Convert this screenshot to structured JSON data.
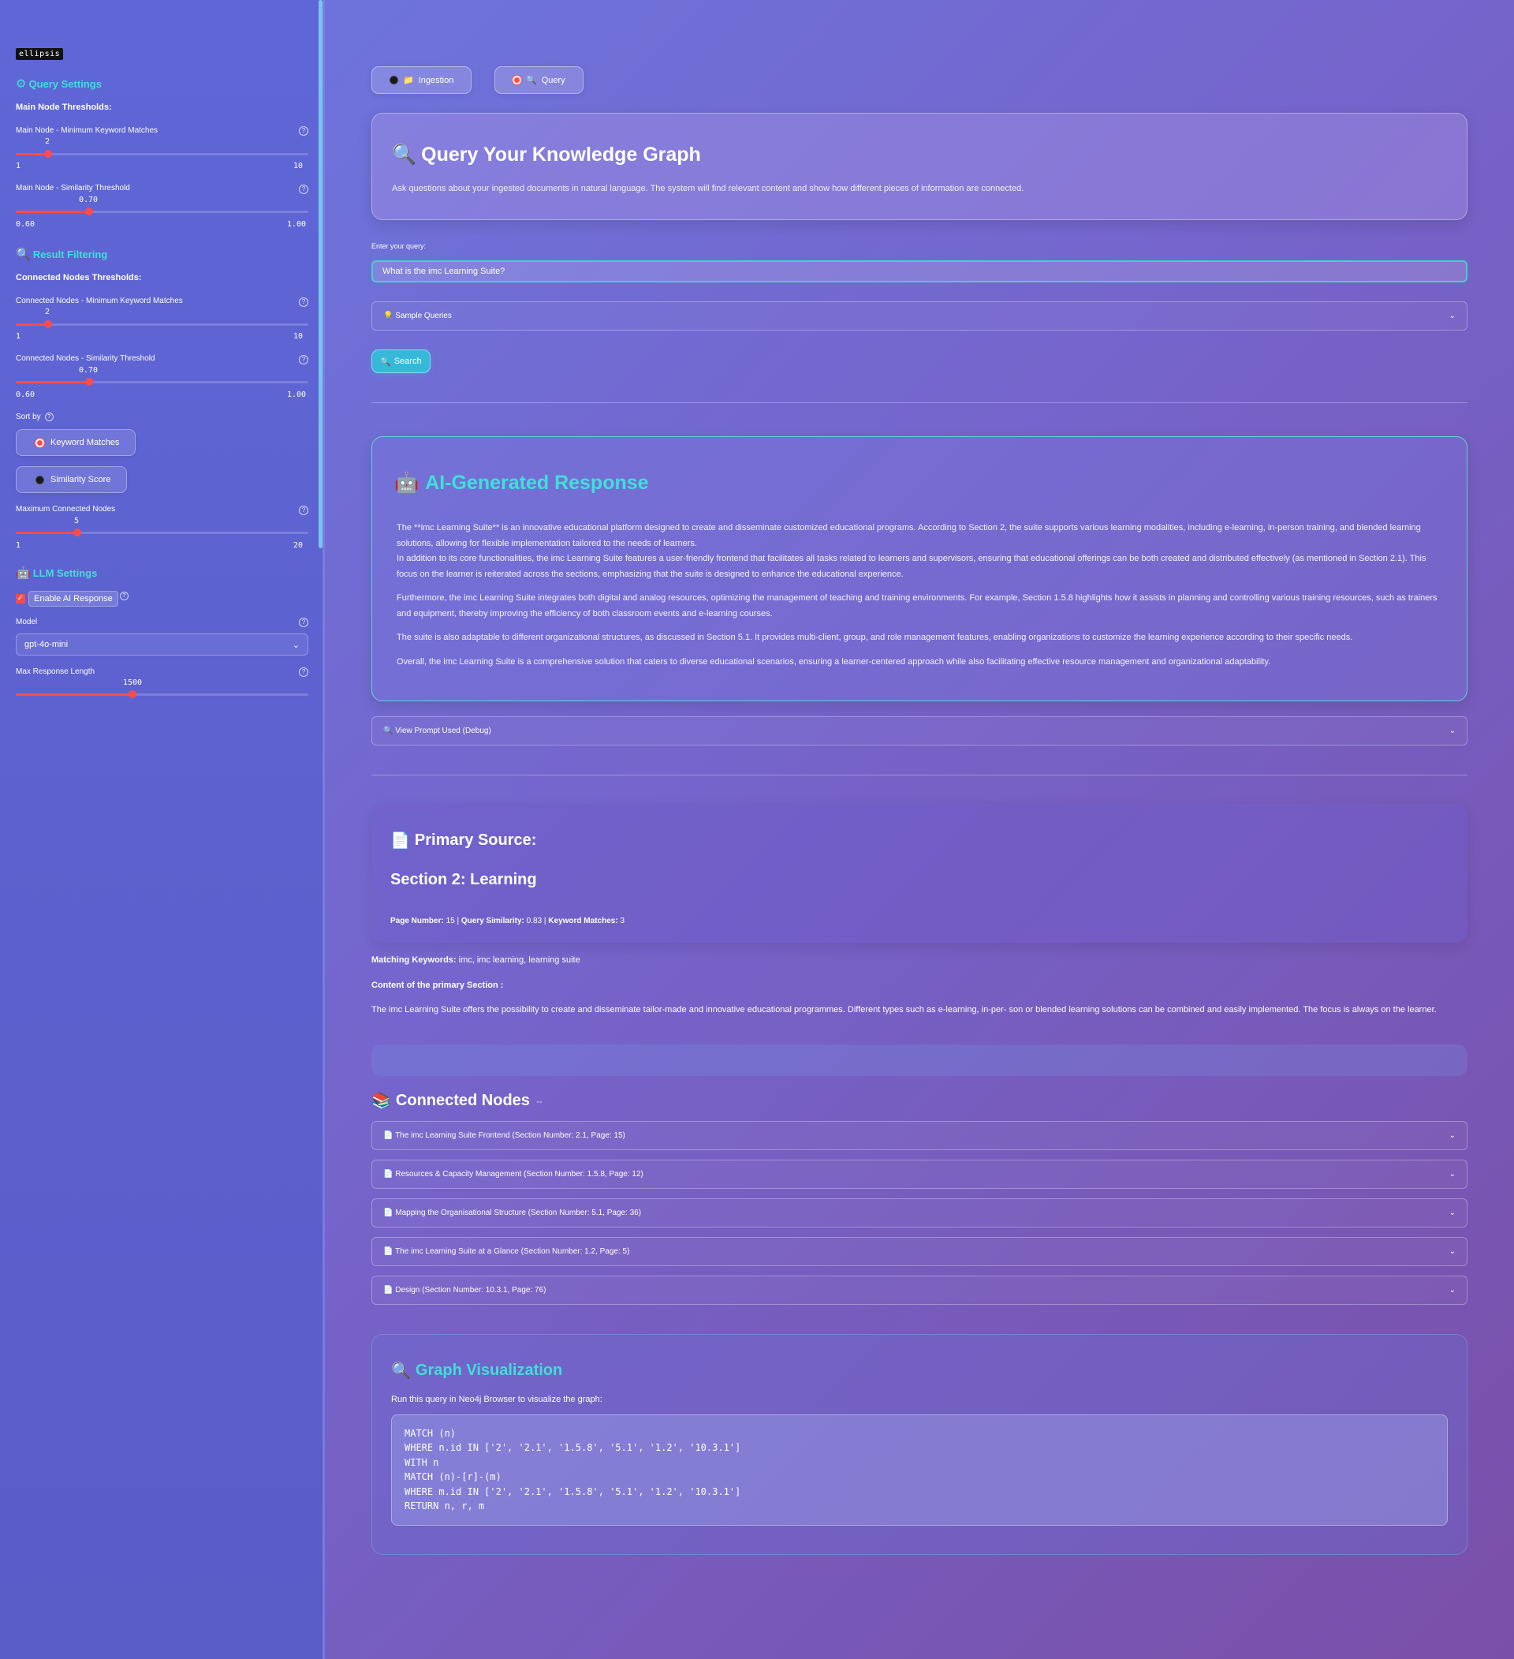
{
  "sidebar": {
    "brand": "ellipsis",
    "query_settings": {
      "title": "Query Settings",
      "main_thresholds_label": "Main Node Thresholds:",
      "min_keyword": {
        "label": "Main Node - Minimum Keyword Matches",
        "value": "2",
        "min": "1",
        "max": "10",
        "fraction": 0.111
      },
      "similarity": {
        "label": "Main Node - Similarity Threshold",
        "value": "0.70",
        "min": "0.60",
        "max": "1.00",
        "fraction": 0.25
      }
    },
    "result_filtering": {
      "title": "Result Filtering",
      "connected_thresholds_label": "Connected Nodes Thresholds:",
      "min_keyword": {
        "label": "Connected Nodes - Minimum Keyword Matches",
        "value": "2",
        "min": "1",
        "max": "10",
        "fraction": 0.111
      },
      "similarity": {
        "label": "Connected Nodes - Similarity Threshold",
        "value": "0.70",
        "min": "0.60",
        "max": "1.00",
        "fraction": 0.25
      },
      "sort_by_label": "Sort by",
      "sort_options": [
        {
          "label": "Keyword Matches",
          "selected": true
        },
        {
          "label": "Similarity Score",
          "selected": false
        }
      ],
      "max_connected": {
        "label": "Maximum Connected Nodes",
        "value": "5",
        "min": "1",
        "max": "20",
        "fraction": 0.21
      }
    },
    "llm_settings": {
      "title": "LLM Settings",
      "enable_ai_label": "Enable AI Response",
      "enable_ai_checked": true,
      "model_label": "Model",
      "model_value": "gpt-4o-mini",
      "max_length": {
        "label": "Max Response Length",
        "value": "1500",
        "fraction": 0.4
      }
    }
  },
  "tabs": [
    {
      "label": "Ingestion",
      "icon": "folder-icon",
      "selected": false
    },
    {
      "label": "Query",
      "icon": "magnifier-icon",
      "selected": true
    }
  ],
  "hero": {
    "title": "Query Your Knowledge Graph",
    "description": "Ask questions about your ingested documents in natural language. The system will find relevant content and show how different pieces of information are connected."
  },
  "query": {
    "label": "Enter your query:",
    "value": "What is the imc Learning Suite?",
    "sample_queries_label": "Sample Queries",
    "search_label": "Search"
  },
  "ai_response": {
    "title": "AI-Generated Response",
    "paragraphs": [
      "The **imc Learning Suite** is an innovative educational platform designed to create and disseminate customized educational programs. According to Section 2, the suite supports various learning modalities, including e-learning, in-person training, and blended learning solutions, allowing for flexible implementation tailored to the needs of learners.",
      "In addition to its core functionalities, the imc Learning Suite features a user-friendly frontend that facilitates all tasks related to learners and supervisors, ensuring that educational offerings can be both created and distributed effectively (as mentioned in Section 2.1). This focus on the learner is reiterated across the sections, emphasizing that the suite is designed to enhance the educational experience.",
      "Furthermore, the imc Learning Suite integrates both digital and analog resources, optimizing the management of teaching and training environments. For example, Section 1.5.8 highlights how it assists in planning and controlling various training resources, such as trainers and equipment, thereby improving the efficiency of both classroom events and e-learning courses.",
      "The suite is also adaptable to different organizational structures, as discussed in Section 5.1. It provides multi-client, group, and role management features, enabling organizations to customize the learning experience according to their specific needs.",
      "Overall, the imc Learning Suite is a comprehensive solution that caters to diverse educational scenarios, ensuring a learner-centered approach while also facilitating effective resource management and organizational adaptability."
    ],
    "debug_label": "View Prompt Used (Debug)"
  },
  "primary_source": {
    "title": "Primary Source:",
    "section": "Section 2: Learning",
    "page_number_label": "Page Number:",
    "page_number": "15",
    "similarity_label": "Query Similarity:",
    "similarity": "0.83",
    "keyword_matches_label": "Keyword Matches:",
    "keyword_matches": "3",
    "matching_keywords_label": "Matching Keywords:",
    "matching_keywords": "imc, imc learning, learning suite",
    "content_label": "Content of the primary Section :",
    "content": "The imc Learning Suite offers the possibility to create and disseminate tailor-made and innovative educational programmes. Different types such as e-learning, in-per- son or blended learning solutions can be combined and easily implemented. The focus is always on the learner."
  },
  "connected_nodes": {
    "title": "Connected Nodes",
    "items": [
      "The imc Learning Suite Frontend (Section Number: 2.1, Page: 15)",
      "Resources & Capacity Management (Section Number: 1.5.8, Page: 12)",
      "Mapping the Organisational Structure (Section Number: 5.1, Page: 36)",
      "The imc Learning Suite at a Glance (Section Number: 1.2, Page: 5)",
      "Design (Section Number: 10.3.1, Page: 76)"
    ]
  },
  "graph": {
    "title": "Graph Visualization",
    "description": "Run this query in Neo4j Browser to visualize the graph:",
    "code": "MATCH (n)\nWHERE n.id IN ['2', '2.1', '1.5.8', '5.1', '1.2', '10.3.1']\nWITH n\nMATCH (n)-[r]-(m)\nWHERE m.id IN ['2', '2.1', '1.5.8', '5.1', '1.2', '10.3.1']\nRETURN n, r, m"
  }
}
